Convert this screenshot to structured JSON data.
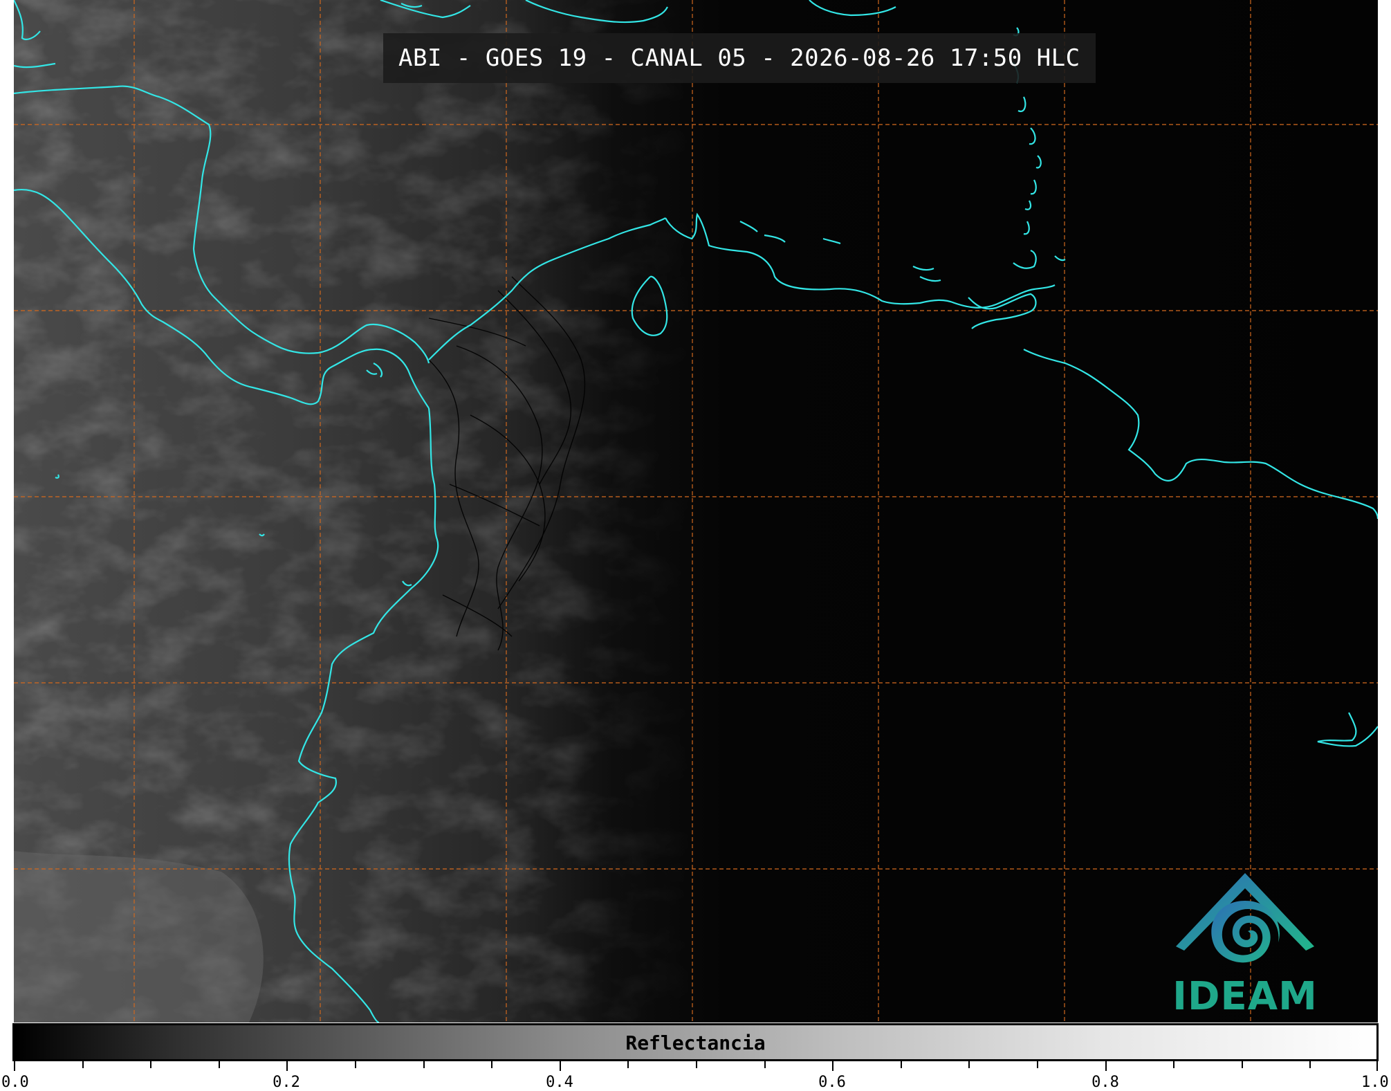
{
  "map": {
    "title": "ABI - GOES 19 - CANAL 05 - 2026-08-26 17:50 HLC",
    "coastline_color": "#33e6e6",
    "gridline_color": "#d2691e",
    "border_color": "#000000"
  },
  "colorbar": {
    "label": "Reflectancia",
    "min": 0.0,
    "max": 1.0,
    "ticks": [
      "0.0",
      "0.2",
      "0.4",
      "0.6",
      "0.8",
      "1.0"
    ],
    "colormap": "grayscale"
  },
  "logo": {
    "text": "IDEAM",
    "color": "#1fa88a",
    "icon": "ideam-logo-icon"
  }
}
